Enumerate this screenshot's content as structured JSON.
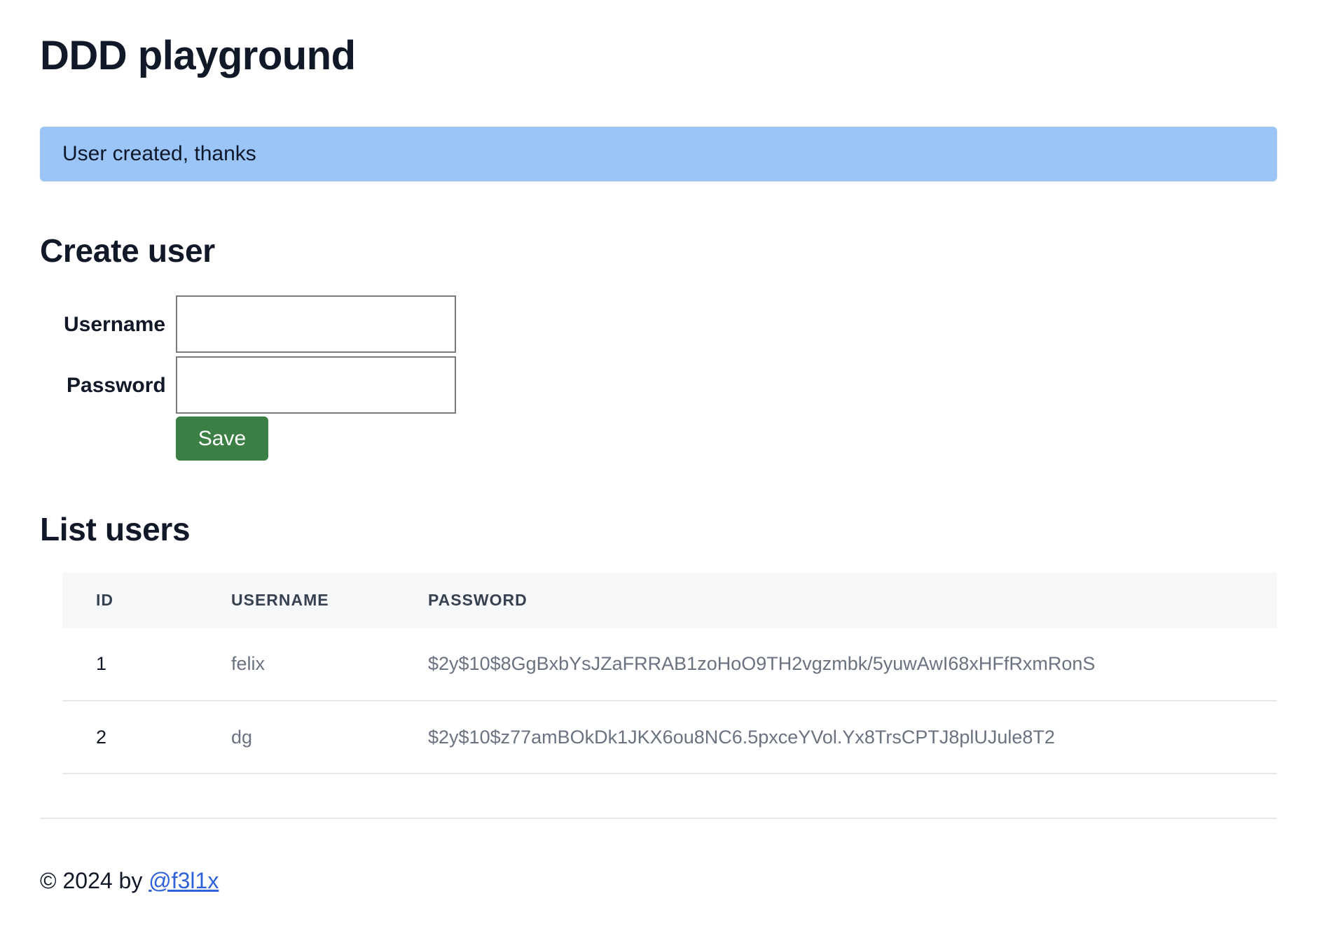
{
  "page": {
    "title": "DDD playground"
  },
  "alert": {
    "message": "User created, thanks",
    "color": "#9bc4f7"
  },
  "create_user": {
    "title": "Create user",
    "username_label": "Username",
    "username_value": "",
    "password_label": "Password",
    "password_value": "",
    "save_label": "Save",
    "save_color": "#3b7f45"
  },
  "list_users": {
    "title": "List users",
    "columns": [
      "ID",
      "USERNAME",
      "PASSWORD"
    ],
    "rows": [
      {
        "id": "1",
        "username": "felix",
        "password": "$2y$10$8GgBxbYsJZaFRRAB1zoHoO9TH2vgzmbk/5yuwAwI68xHFfRxmRonS"
      },
      {
        "id": "2",
        "username": "dg",
        "password": "$2y$10$z77amBOkDk1JKX6ou8NC6.5pxceYVol.Yx8TrsCPTJ8plUJule8T2"
      }
    ]
  },
  "footer": {
    "prefix": "© 2024 by ",
    "link_text": "@f3l1x",
    "link_color": "#2f62d8"
  }
}
